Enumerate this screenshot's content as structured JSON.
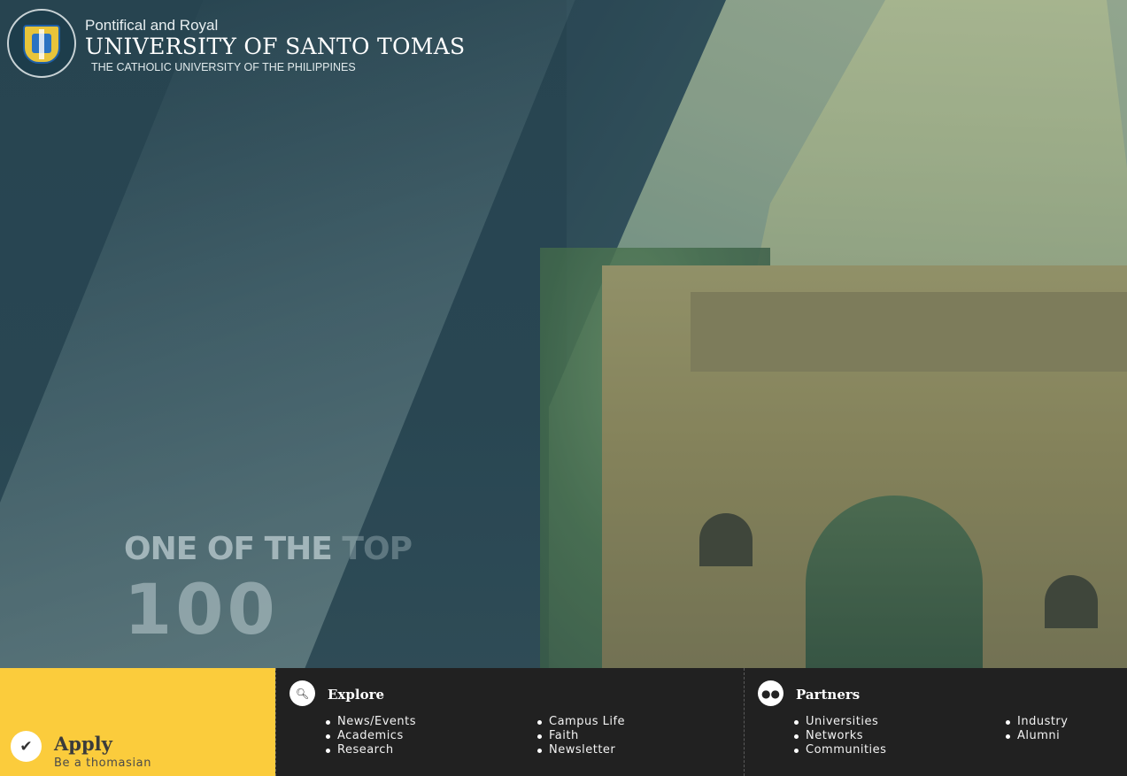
{
  "header": {
    "kicker": "Pontifical and Royal",
    "name": "UNIVERSITY OF SANTO TOMAS",
    "tagline": "THE CATHOLIC UNIVERSITY OF THE PHILIPPINES",
    "seal_icon": "ust-seal-icon"
  },
  "hero": {
    "teaser_line1_main": "ONE OF THE",
    "teaser_line1_fade": "TOP",
    "teaser_line2": "100"
  },
  "footer": {
    "apply": {
      "label": "Apply",
      "sub": "Be a thomasian",
      "icon": "check-icon",
      "bg": "#fbcc3c"
    },
    "explore": {
      "title": "Explore",
      "icon": "search-icon",
      "col1": [
        "News/Events",
        "Academics",
        "Research"
      ],
      "col2": [
        "Campus Life",
        "Faith",
        "Newsletter"
      ]
    },
    "partners": {
      "title": "Partners",
      "icon": "group-icon",
      "col1": [
        "Universities",
        "Networks",
        "Communities"
      ],
      "col2": [
        "Industry",
        "Alumni"
      ]
    },
    "panel_bg": "#212121"
  }
}
